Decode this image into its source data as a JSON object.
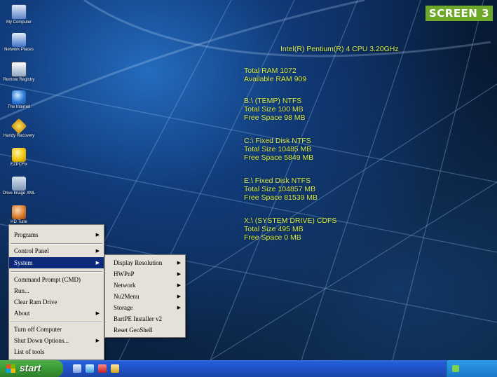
{
  "badge": "SCREEN 3",
  "desktop_icons": [
    {
      "label": "My Computer",
      "icon": "computer-icon"
    },
    {
      "label": "Network Places",
      "icon": "network-icon"
    },
    {
      "label": "Remote Registry",
      "icon": "remote-registry-icon"
    },
    {
      "label": "The Internet",
      "icon": "internet-icon"
    },
    {
      "label": "Handy Recovery",
      "icon": "handy-recovery-icon"
    },
    {
      "label": "EZPCFix",
      "icon": "ezpcfix-icon"
    },
    {
      "label": "Drive Image XML",
      "icon": "drive-image-icon"
    },
    {
      "label": "HD Tune",
      "icon": "hd-tune-icon"
    }
  ],
  "sysinfo": {
    "cpu": "Intel(R) Pentium(R) 4 CPU 3.20GHz",
    "ram_total": "Total RAM  1072",
    "ram_available": "Available RAM  909",
    "drives": [
      {
        "name": "B:\\  (TEMP)  NTFS",
        "total": "Total Size  100 MB",
        "free": "Free Space  98 MB"
      },
      {
        "name": "C:\\  Fixed Disk  NTFS",
        "total": "Total Size  10485 MB",
        "free": "Free Space  5849 MB"
      },
      {
        "name": "E:\\  Fixed Disk  NTFS",
        "total": "Total Size  104857 MB",
        "free": "Free Space  81539 MB"
      },
      {
        "name": "X:\\  (SYSTEM DRIVE)  CDFS",
        "total": "Total Size  495 MB",
        "free": "Free Space  0 MB"
      }
    ]
  },
  "start_menu": {
    "items": [
      {
        "label": "Programs",
        "submenu": true
      },
      {
        "label": "Control Panel",
        "submenu": true
      },
      {
        "label": "System",
        "submenu": true,
        "selected": true
      },
      {
        "label": "Command Prompt (CMD)",
        "submenu": false
      },
      {
        "label": "Run...",
        "submenu": false
      },
      {
        "label": "Clear Ram Drive",
        "submenu": false
      },
      {
        "label": "About",
        "submenu": true
      },
      {
        "label": "Turn off Computer",
        "submenu": false
      },
      {
        "label": "Shut Down Options...",
        "submenu": true
      },
      {
        "label": "List of tools",
        "submenu": false
      }
    ]
  },
  "system_submenu": {
    "items": [
      {
        "label": "Display Resolution",
        "submenu": true
      },
      {
        "label": "HWPnP",
        "submenu": true
      },
      {
        "label": "Network",
        "submenu": true
      },
      {
        "label": "Nu2Menu",
        "submenu": true
      },
      {
        "label": "Storage",
        "submenu": true
      },
      {
        "label": "BartPE Installer v2",
        "submenu": false
      },
      {
        "label": "Reset GeoShell",
        "submenu": false
      }
    ]
  },
  "taskbar": {
    "start_label": "start",
    "quick_launch": [
      "desktop-icon",
      "explorer-icon",
      "tool-icon",
      "folder-icon"
    ],
    "tray_text": ""
  },
  "colors": {
    "badge": "#6ea82a",
    "sysinfo_text": "#d8ef4a",
    "menu_bg": "#e4e1d8",
    "menu_selected": "#0b2a7a",
    "taskbar": "#245edb",
    "start_button": "#3a9a35"
  }
}
